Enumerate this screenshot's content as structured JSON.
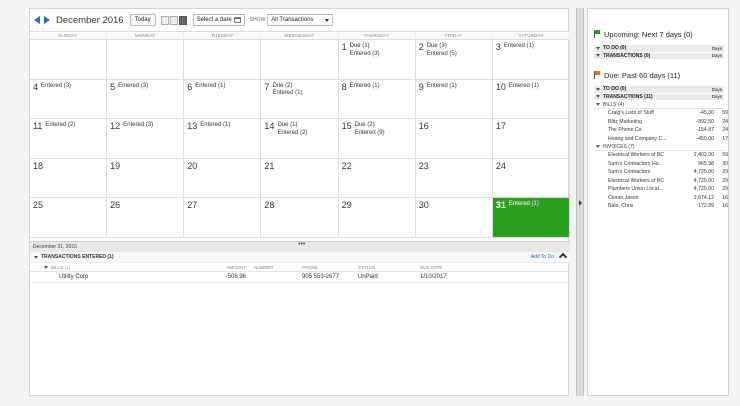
{
  "toolbar": {
    "month_title": "December 2016",
    "today_label": "Today",
    "date_placeholder": "Select a date",
    "show_label": "SHOW",
    "filter_value": "All Transactions"
  },
  "calendar": {
    "weekdays": [
      "SUNDAY",
      "MONDAY",
      "TUESDAY",
      "WEDNESDAY",
      "THURSDAY",
      "FRIDAY",
      "SATURDAY"
    ],
    "weeks": [
      [
        {
          "day": "",
          "entries": []
        },
        {
          "day": "",
          "entries": []
        },
        {
          "day": "",
          "entries": []
        },
        {
          "day": "",
          "entries": []
        },
        {
          "day": "1",
          "entries": [
            "Due (1)",
            "Entered (3)"
          ]
        },
        {
          "day": "2",
          "entries": [
            "Due (3)",
            "Entered (5)"
          ]
        },
        {
          "day": "3",
          "entries": [
            "Entered (1)"
          ]
        }
      ],
      [
        {
          "day": "4",
          "entries": [
            "Entered (3)"
          ]
        },
        {
          "day": "5",
          "entries": [
            "Entered (3)"
          ]
        },
        {
          "day": "6",
          "entries": [
            "Entered (1)"
          ]
        },
        {
          "day": "7",
          "entries": [
            "Due (2)",
            "Entered (1)"
          ]
        },
        {
          "day": "8",
          "entries": [
            "Entered (1)"
          ]
        },
        {
          "day": "9",
          "entries": [
            "Entered (1)"
          ]
        },
        {
          "day": "10",
          "entries": [
            "Entered (1)"
          ]
        }
      ],
      [
        {
          "day": "11",
          "entries": [
            "Entered (2)"
          ]
        },
        {
          "day": "12",
          "entries": [
            "Entered (3)"
          ]
        },
        {
          "day": "13",
          "entries": [
            "Entered (1)"
          ]
        },
        {
          "day": "14",
          "entries": [
            "Due (1)",
            "Entered (2)"
          ]
        },
        {
          "day": "15",
          "entries": [
            "Due (2)",
            "Entered (9)"
          ]
        },
        {
          "day": "16",
          "entries": []
        },
        {
          "day": "17",
          "entries": []
        }
      ],
      [
        {
          "day": "18",
          "entries": []
        },
        {
          "day": "19",
          "entries": []
        },
        {
          "day": "20",
          "entries": []
        },
        {
          "day": "21",
          "entries": []
        },
        {
          "day": "22",
          "entries": []
        },
        {
          "day": "23",
          "entries": []
        },
        {
          "day": "24",
          "entries": []
        }
      ],
      [
        {
          "day": "25",
          "entries": []
        },
        {
          "day": "26",
          "entries": []
        },
        {
          "day": "27",
          "entries": []
        },
        {
          "day": "28",
          "entries": []
        },
        {
          "day": "29",
          "entries": []
        },
        {
          "day": "30",
          "entries": []
        },
        {
          "day": "31",
          "entries": [
            "Entered (1)"
          ],
          "today": true
        }
      ]
    ]
  },
  "detail": {
    "date": "December 31, 2016",
    "dots": "•••",
    "section_title": "TRANSACTIONS ENTERED (1)",
    "add_todo": "Add To Do",
    "bills_label": "BILLS (1)",
    "columns": [
      "AMOUNT",
      "NUMBER",
      "PHONE",
      "STATUS",
      "DUE DATE"
    ],
    "rows": [
      {
        "name": "Utility Corp",
        "amount": "-508.96",
        "number": "",
        "phone": "905 553-2677",
        "status": "UnPaid",
        "due": "1/10/2017"
      }
    ]
  },
  "sidebar": {
    "upcoming_title": "Upcoming: Next 7 days (0)",
    "upcoming_sections": [
      {
        "label": "TO DO (0)",
        "days": "Days"
      },
      {
        "label": "TRANSACTIONS (0)",
        "days": "Days"
      }
    ],
    "due_title": "Due: Past 60 days (11)",
    "due_todo": {
      "label": "TO DO (0)",
      "days": "Days"
    },
    "due_transactions": {
      "label": "TRANSACTIONS (11)",
      "days": "Days"
    },
    "bills_label": "BILLS (4)",
    "bills": [
      {
        "name": "Craig's Lists of Stuff",
        "amount": "-45.00",
        "days": "59"
      },
      {
        "name": "Blitz Marketing",
        "amount": "-892.50",
        "days": "24"
      },
      {
        "name": "The Phone Co",
        "amount": "-154.87",
        "days": "24"
      },
      {
        "name": "Hoang and Company C...",
        "amount": "-450.00",
        "days": "17"
      }
    ],
    "invoices_label": "INVOICES (7)",
    "invoices": [
      {
        "name": "Electrical Workers of BC",
        "amount": "2,402.00",
        "days": "59"
      },
      {
        "name": "Sam's Contractors Ho...",
        "amount": "965.98",
        "days": "30"
      },
      {
        "name": "Sam's Contractors",
        "amount": "4,725.00",
        "days": "29"
      },
      {
        "name": "Electrical Workers of BC",
        "amount": "4,725.00",
        "days": "29"
      },
      {
        "name": "Plumbers Union Local...",
        "amount": "4,725.00",
        "days": "29"
      },
      {
        "name": "Cioran,Jason",
        "amount": "2,674.12",
        "days": "16"
      },
      {
        "name": "Bain, Chris",
        "amount": "172.89",
        "days": "16"
      }
    ]
  },
  "colors": {
    "accent": "#2a6fcb",
    "today": "#2ca01c",
    "flag_upcoming": "#2ca01c",
    "flag_due": "#e07a16"
  }
}
